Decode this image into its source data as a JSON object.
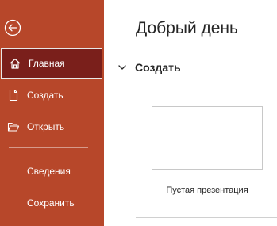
{
  "sidebar": {
    "back_icon": "back-arrow-icon",
    "items": [
      {
        "label": "Главная",
        "icon": "home-icon",
        "active": true
      },
      {
        "label": "Создать",
        "icon": "new-document-icon"
      },
      {
        "label": "Открыть",
        "icon": "open-folder-icon"
      },
      {
        "label": "Сведения"
      },
      {
        "label": "Сохранить"
      }
    ],
    "colors": {
      "background": "#b7472a",
      "active": "#7a1f1b"
    }
  },
  "main": {
    "greeting": "Добрый день",
    "section_title": "Создать",
    "templates": [
      {
        "label": "Пустая презентация"
      }
    ]
  }
}
